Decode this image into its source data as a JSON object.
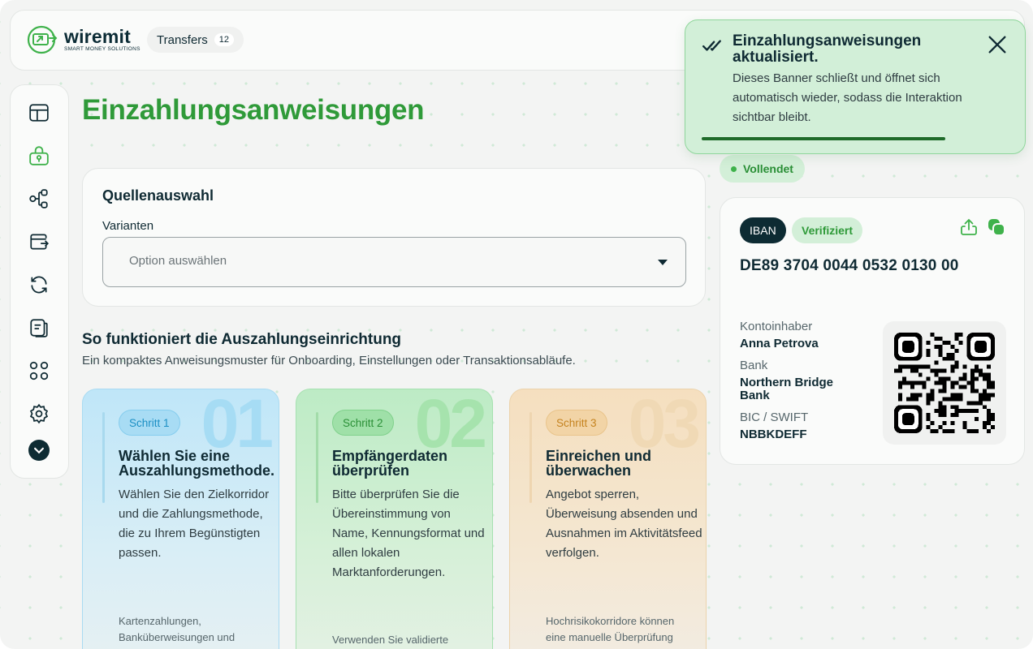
{
  "header": {
    "brand": "wiremit",
    "brand_tagline": "SMART MONEY SOLUTIONS",
    "transfers_label": "Transfers",
    "transfers_count": "12"
  },
  "sidebar": {
    "items": [
      {
        "icon": "layout-icon"
      },
      {
        "icon": "deposit-lock-icon",
        "active": true
      },
      {
        "icon": "network-icon"
      },
      {
        "icon": "wallet-transfer-icon"
      },
      {
        "icon": "refresh-icon"
      },
      {
        "icon": "documents-icon"
      },
      {
        "icon": "apps-icon"
      },
      {
        "icon": "gear-icon"
      },
      {
        "icon": "chevron-down-icon"
      }
    ]
  },
  "page": {
    "title": "Einzahlungsanweisungen"
  },
  "source": {
    "title": "Quellenauswahl",
    "variant_label": "Varianten",
    "select_placeholder": "Option auswählen"
  },
  "section": {
    "title": "So funktioniert die Auszahlungseinrichtung",
    "subtitle": "Ein kompaktes Anweisungsmuster für Onboarding, Einstellungen oder Transaktionsabläufe."
  },
  "steps": [
    {
      "number": "01",
      "pill": "Schritt 1",
      "heading": "Wählen Sie eine Auszahlungsmethode.",
      "body": "Wählen Sie den Zielkorridor und die Zahlungsmethode, die zu Ihrem Begünstigten passen.",
      "note": "Kartenzahlungen, Banküberweisungen und Wallet-Zahlungen können"
    },
    {
      "number": "02",
      "pill": "Schritt 2",
      "heading": "Empfängerdaten überprüfen",
      "body": "Bitte überprüfen Sie die Übereinstimmung von Name, Kennungsformat und allen lokalen Marktanforderungen.",
      "note": "Verwenden Sie validierte"
    },
    {
      "number": "03",
      "pill": "Schritt 3",
      "heading": "Einreichen und überwachen",
      "body": "Angebot sperren, Überweisung absenden und Ausnahmen im Aktivitätsfeed verfolgen.",
      "note": "Hochrisikokorridore können eine manuelle Überprüfung erfordern."
    }
  ],
  "status": {
    "label": "Vollendet"
  },
  "account": {
    "type_badge": "IBAN",
    "verified_badge": "Verifiziert",
    "iban": "DE89 3704 0044 0532 0130 00",
    "holder_label": "Kontoinhaber",
    "holder_value": "Anna Petrova",
    "bank_label": "Bank",
    "bank_value": "Northern Bridge Bank",
    "bic_label": "BIC / SWIFT",
    "bic_value": "NBBKDEFF"
  },
  "toast": {
    "title": "Einzahlungsanweisungen aktualisiert.",
    "message": "Dieses Banner schließt und öffnet sich automatisch wieder, sodass die Interaktion sichtbar bleibt.",
    "progress": 0.79
  },
  "colors": {
    "brand_green": "#2f9a39",
    "dark": "#0d2b33",
    "toast_bg": "#d2efd8"
  }
}
